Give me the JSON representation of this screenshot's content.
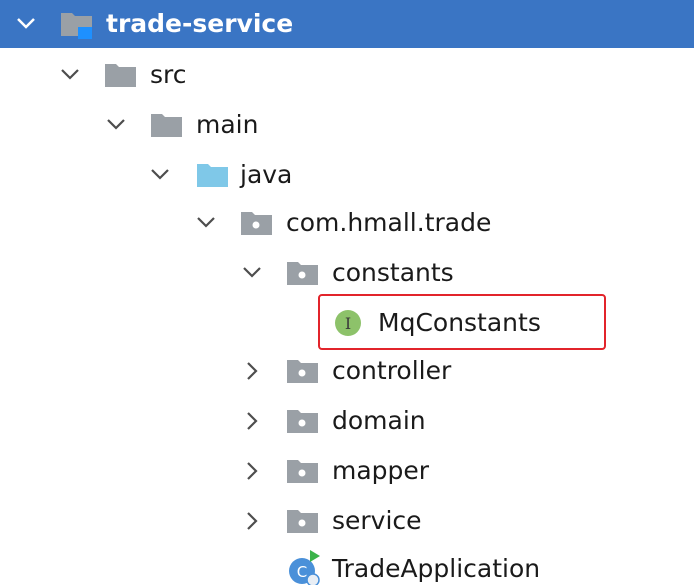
{
  "tree": {
    "root": {
      "label": "trade-service",
      "icon": "module-folder-icon",
      "expanded": true,
      "selected": true
    },
    "src": {
      "label": "src",
      "icon": "folder-icon",
      "expanded": true
    },
    "main": {
      "label": "main",
      "icon": "folder-icon",
      "expanded": true
    },
    "java": {
      "label": "java",
      "icon": "source-root-folder-icon",
      "expanded": true
    },
    "package": {
      "label": "com.hmall.trade",
      "icon": "package-icon",
      "expanded": true
    },
    "constants": {
      "label": "constants",
      "icon": "package-icon",
      "expanded": true
    },
    "mqconstants": {
      "label": "MqConstants",
      "icon": "interface-icon",
      "icon_letter": "I",
      "highlighted": true
    },
    "controller": {
      "label": "controller",
      "icon": "package-icon",
      "expanded": false
    },
    "domain": {
      "label": "domain",
      "icon": "package-icon",
      "expanded": false
    },
    "mapper": {
      "label": "mapper",
      "icon": "package-icon",
      "expanded": false
    },
    "service": {
      "label": "service",
      "icon": "package-icon",
      "expanded": false
    },
    "tradeapplication": {
      "label": "TradeApplication",
      "icon": "spring-boot-class-icon",
      "icon_letter": "C"
    }
  },
  "colors": {
    "selection": "#3a75c4",
    "highlight_border": "#e2242b",
    "folder_gray": "#9aa0a6",
    "source_root_blue": "#7fc8e8",
    "interface_green": "#8dc26a",
    "class_blue": "#4a90d9"
  }
}
